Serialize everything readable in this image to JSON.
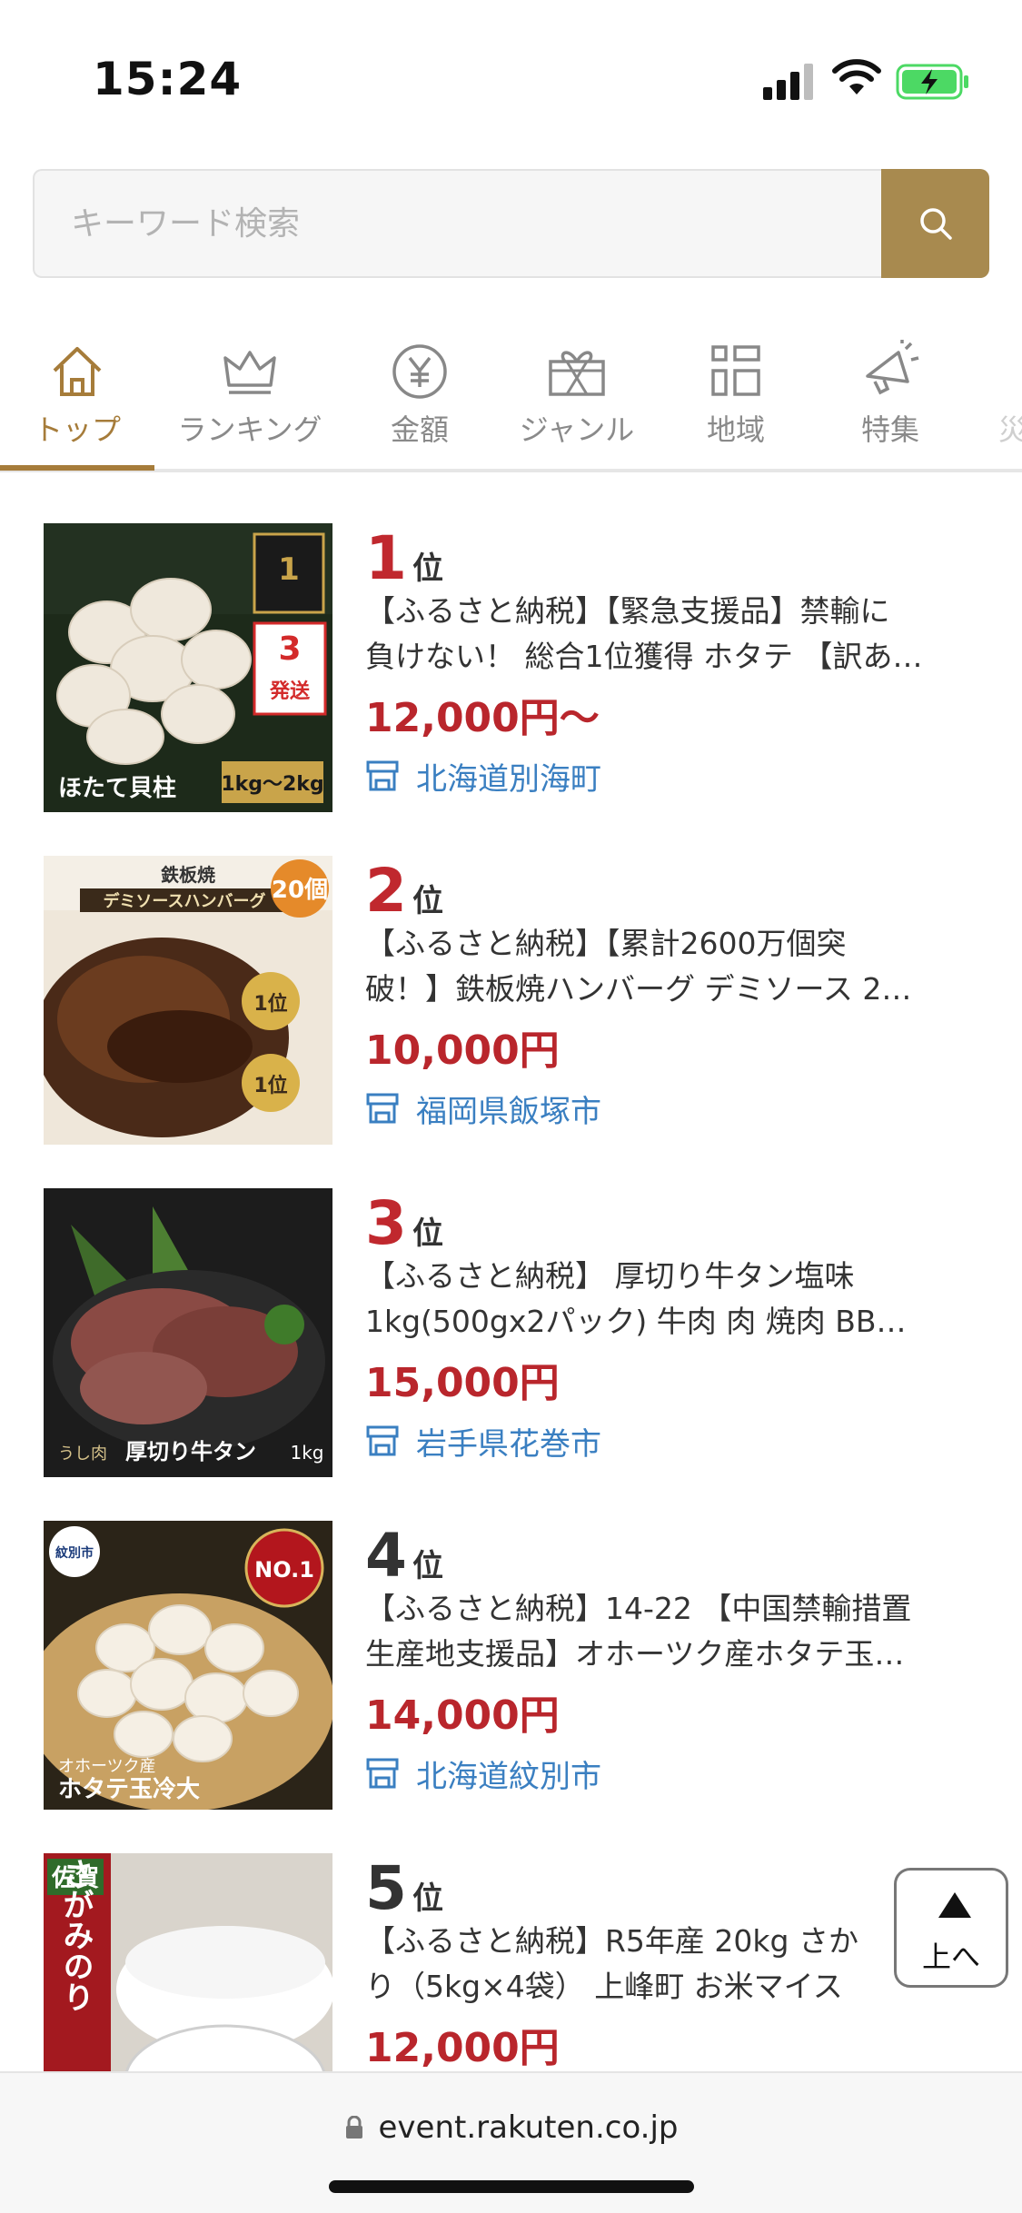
{
  "status_bar": {
    "time": "15:24"
  },
  "search": {
    "placeholder": "キーワード検索"
  },
  "tabs": [
    {
      "label": "トップ",
      "icon": "home-icon",
      "active": true
    },
    {
      "label": "ランキング",
      "icon": "crown-icon"
    },
    {
      "label": "金額",
      "icon": "yen-icon"
    },
    {
      "label": "ジャンル",
      "icon": "gift-icon"
    },
    {
      "label": "地域",
      "icon": "buildings-icon"
    },
    {
      "label": "特集",
      "icon": "megaphone-icon"
    },
    {
      "label": "災"
    }
  ],
  "items": [
    {
      "rank": "1",
      "rank_suffix": "位",
      "title_line1": "【ふるさと納税】【緊急支援品】禁輸に",
      "title_line2": "負けない！ 総合1位獲得 ホタテ 【訳あ…",
      "price": "12,000円〜",
      "location": "北海道別海町",
      "image_text": "ほたて貝柱",
      "image_badge": "1kg〜2kg",
      "image_label": "3営業日発送"
    },
    {
      "rank": "2",
      "rank_suffix": "位",
      "title_line1": "【ふるさと納税】【累計2600万個突",
      "title_line2": "破！】鉄板焼ハンバーグ デミソース 2…",
      "price": "10,000円",
      "location": "福岡県飯塚市",
      "image_text": "鉄板焼 デミソースハンバーグ",
      "image_badge": "20個",
      "image_label": "第1位"
    },
    {
      "rank": "3",
      "rank_suffix": "位",
      "title_line1": "【ふるさと納税】 厚切り牛タン塩味",
      "title_line2": "1kg(500gx2パック) 牛肉 肉 焼肉 BB…",
      "price": "15,000円",
      "location": "岩手県花巻市",
      "image_text": "厚切り牛タン",
      "image_badge": "1kg"
    },
    {
      "rank": "4",
      "rank_suffix": "位",
      "title_line1": "【ふるさと納税】14-22 【中国禁輸措置",
      "title_line2": "生産地支援品】オホーツク産ホタテ玉…",
      "price": "14,000円",
      "location": "北海道紋別市",
      "image_text": "ホタテ玉冷大",
      "image_badge": "NO.1",
      "image_label": "紋別市"
    },
    {
      "rank": "5",
      "rank_suffix": "位",
      "title_line1": "【ふるさと納税】R5年産 20kg さか",
      "title_line2": "り（5kg×4袋） 上峰町 お米マイス",
      "price": "12,000円",
      "image_text": "さがみのり",
      "image_badge": "佐賀"
    }
  ],
  "to_top": {
    "label": "上へ"
  },
  "url_bar": {
    "url": "event.rakuten.co.jp"
  },
  "colors": {
    "accent": "#a88a4f",
    "rank_red": "#c0282e",
    "price_red": "#b9262c",
    "link_blue": "#3a7fc1",
    "tab_active": "#a67c3a"
  }
}
